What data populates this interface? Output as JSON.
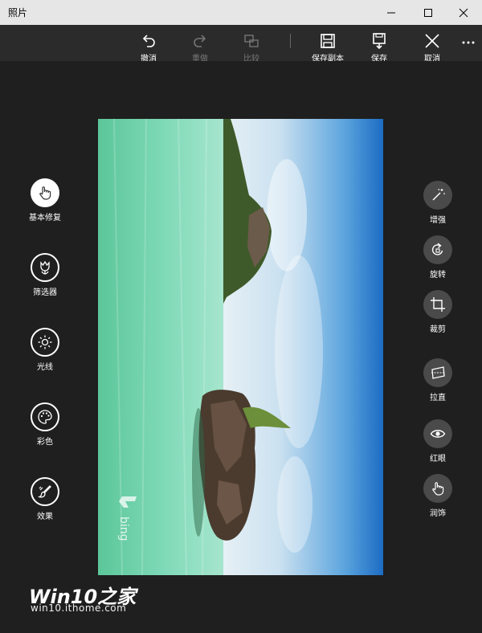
{
  "window": {
    "title": "照片"
  },
  "commandbar": {
    "undo": "撤消",
    "redo": "重做",
    "compare": "比较",
    "save_copy": "保存副本",
    "save": "保存",
    "cancel": "取消"
  },
  "left_tools": [
    {
      "label": "基本修复",
      "icon": "touch-icon",
      "active": true
    },
    {
      "label": "筛选器",
      "icon": "tulip-icon"
    },
    {
      "label": "光线",
      "icon": "sun-icon"
    },
    {
      "label": "彩色",
      "icon": "palette-icon"
    },
    {
      "label": "效果",
      "icon": "brush-icon"
    }
  ],
  "right_tools": [
    {
      "label": "增强",
      "icon": "magic-wand-icon"
    },
    {
      "label": "旋转",
      "icon": "rotate-icon"
    },
    {
      "label": "裁剪",
      "icon": "crop-icon"
    },
    {
      "label": "拉直",
      "icon": "straighten-icon"
    },
    {
      "label": "红眼",
      "icon": "eye-icon"
    },
    {
      "label": "润饰",
      "icon": "retouch-hand-icon"
    }
  ],
  "photo": {
    "brand": "bing"
  },
  "watermark": {
    "main": "Win10之家",
    "sub": "win10.ithome.com"
  },
  "colors": {
    "titlebar": "#e6e6e6",
    "commandbar": "#2b2b2b",
    "canvas": "#1f1f1f",
    "tool_bg": "#4a4a4a"
  }
}
